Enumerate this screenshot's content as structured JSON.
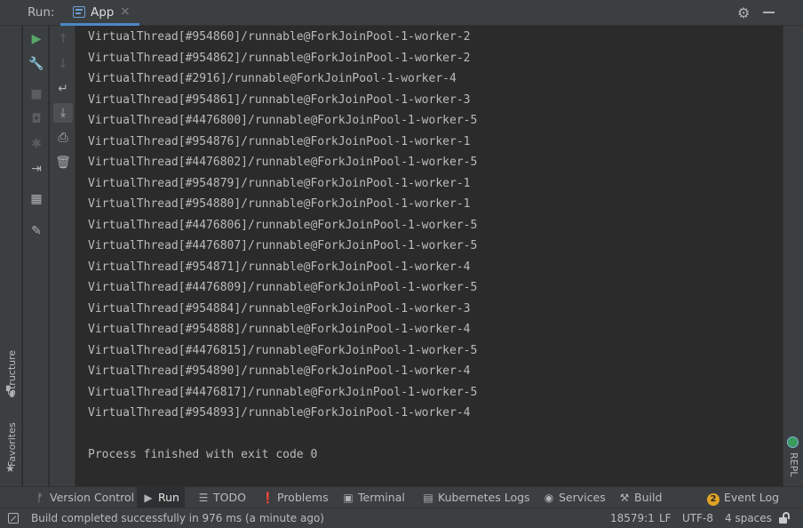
{
  "header": {
    "run_label": "Run:",
    "tab_label": "App",
    "close_glyph": "×",
    "settings_glyph": "⚙"
  },
  "left_stripe": {
    "structure_label": "Structure",
    "favorites_label": "Favorites"
  },
  "right_stripe": {
    "repl_label": "REPL"
  },
  "toolbar_left": [
    {
      "icon": "run-icon",
      "glyph": "▶"
    },
    {
      "icon": "wrench-icon",
      "glyph": "🔧"
    },
    {
      "icon": "stop-icon",
      "glyph": "■"
    },
    {
      "icon": "camera-icon",
      "glyph": "◘"
    },
    {
      "icon": "debug-icon",
      "glyph": "✱"
    },
    {
      "icon": "exit-icon",
      "glyph": "⇥"
    },
    {
      "icon": "layout-icon",
      "glyph": "▦"
    },
    {
      "icon": "pin-icon",
      "glyph": "✎"
    }
  ],
  "toolbar_right": [
    {
      "icon": "up-arrow-icon",
      "glyph": "↑"
    },
    {
      "icon": "down-arrow-icon",
      "glyph": "↓"
    },
    {
      "icon": "soft-wrap-icon",
      "glyph": "↵"
    },
    {
      "icon": "scroll-to-end-icon",
      "glyph": "⤓"
    },
    {
      "icon": "print-icon",
      "glyph": "⎙"
    },
    {
      "icon": "trash-icon",
      "glyph": "🗑"
    }
  ],
  "console": {
    "lines": [
      "VirtualThread[#954860]/runnable@ForkJoinPool-1-worker-2",
      "VirtualThread[#954862]/runnable@ForkJoinPool-1-worker-2",
      "VirtualThread[#2916]/runnable@ForkJoinPool-1-worker-4",
      "VirtualThread[#954861]/runnable@ForkJoinPool-1-worker-3",
      "VirtualThread[#4476800]/runnable@ForkJoinPool-1-worker-5",
      "VirtualThread[#954876]/runnable@ForkJoinPool-1-worker-1",
      "VirtualThread[#4476802]/runnable@ForkJoinPool-1-worker-5",
      "VirtualThread[#954879]/runnable@ForkJoinPool-1-worker-1",
      "VirtualThread[#954880]/runnable@ForkJoinPool-1-worker-1",
      "VirtualThread[#4476806]/runnable@ForkJoinPool-1-worker-5",
      "VirtualThread[#4476807]/runnable@ForkJoinPool-1-worker-5",
      "VirtualThread[#954871]/runnable@ForkJoinPool-1-worker-4",
      "VirtualThread[#4476809]/runnable@ForkJoinPool-1-worker-5",
      "VirtualThread[#954884]/runnable@ForkJoinPool-1-worker-3",
      "VirtualThread[#954888]/runnable@ForkJoinPool-1-worker-4",
      "VirtualThread[#4476815]/runnable@ForkJoinPool-1-worker-5",
      "VirtualThread[#954890]/runnable@ForkJoinPool-1-worker-4",
      "VirtualThread[#4476817]/runnable@ForkJoinPool-1-worker-5",
      "VirtualThread[#954893]/runnable@ForkJoinPool-1-worker-4"
    ],
    "exit_message": "Process finished with exit code 0"
  },
  "bottom_tabs": [
    {
      "label": "Version Control",
      "icon": "branch-icon",
      "glyph": "ᚠ"
    },
    {
      "label": "Run",
      "icon": "run-icon",
      "glyph": "▶"
    },
    {
      "label": "TODO",
      "icon": "list-icon",
      "glyph": "☰"
    },
    {
      "label": "Problems",
      "icon": "problems-icon",
      "glyph": "❗"
    },
    {
      "label": "Terminal",
      "icon": "terminal-icon",
      "glyph": "▣"
    },
    {
      "label": "Kubernetes Logs",
      "icon": "document-icon",
      "glyph": "▤"
    },
    {
      "label": "Services",
      "icon": "services-icon",
      "glyph": "◉"
    },
    {
      "label": "Build",
      "icon": "hammer-icon",
      "glyph": "⚒"
    },
    {
      "label": "Event Log",
      "icon": "event-log-badge",
      "badge": "2"
    }
  ],
  "status_bar": {
    "message": "Build completed successfully in 976 ms (a minute ago)",
    "position": "18579:1",
    "line_separator": "LF",
    "encoding": "UTF-8",
    "indent": "4 spaces"
  },
  "colors": {
    "accent": "#4a88c7",
    "run_green": "#59a869",
    "badge_orange": "#e0a323"
  }
}
